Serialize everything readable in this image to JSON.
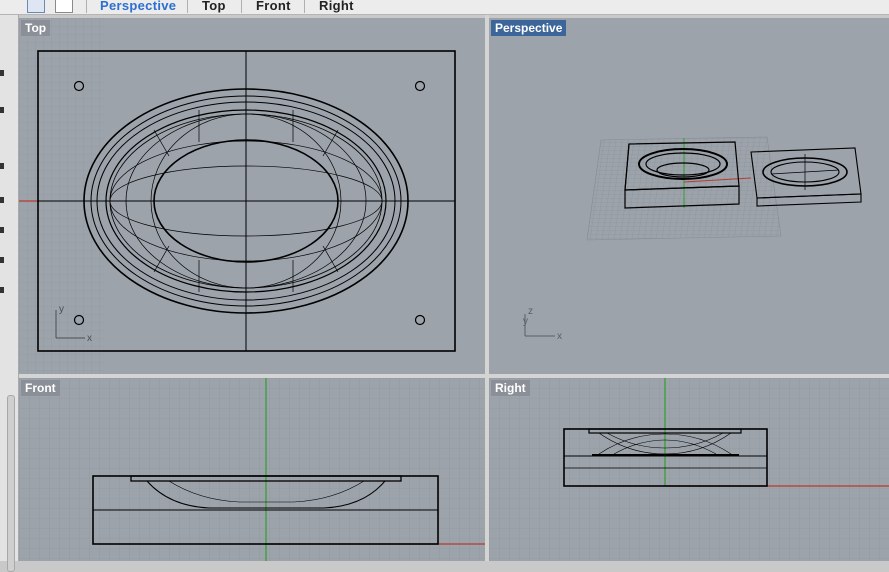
{
  "toolbar": {
    "tabs": [
      {
        "label": "Perspective",
        "active": true
      },
      {
        "label": "Top",
        "active": false
      },
      {
        "label": "Front",
        "active": false
      },
      {
        "label": "Right",
        "active": false
      }
    ],
    "icons": [
      "four-viewport-layout-icon",
      "single-viewport-layout-icon"
    ]
  },
  "viewports": {
    "top": {
      "title": "Top",
      "axis_x": "x",
      "axis_y": "y"
    },
    "perspective": {
      "title": "Perspective",
      "active": true,
      "axis_x": "x",
      "axis_y": "y",
      "axis_z": "z"
    },
    "front": {
      "title": "Front"
    },
    "right": {
      "title": "Right"
    }
  },
  "colors": {
    "viewport_bg": "#9da3ab",
    "grid_line": "#8b9199",
    "x_axis": "#b83a2e",
    "y_axis": "#2fa02f",
    "active_label": "#3c6699",
    "tab_active": "#2d6fd0"
  }
}
